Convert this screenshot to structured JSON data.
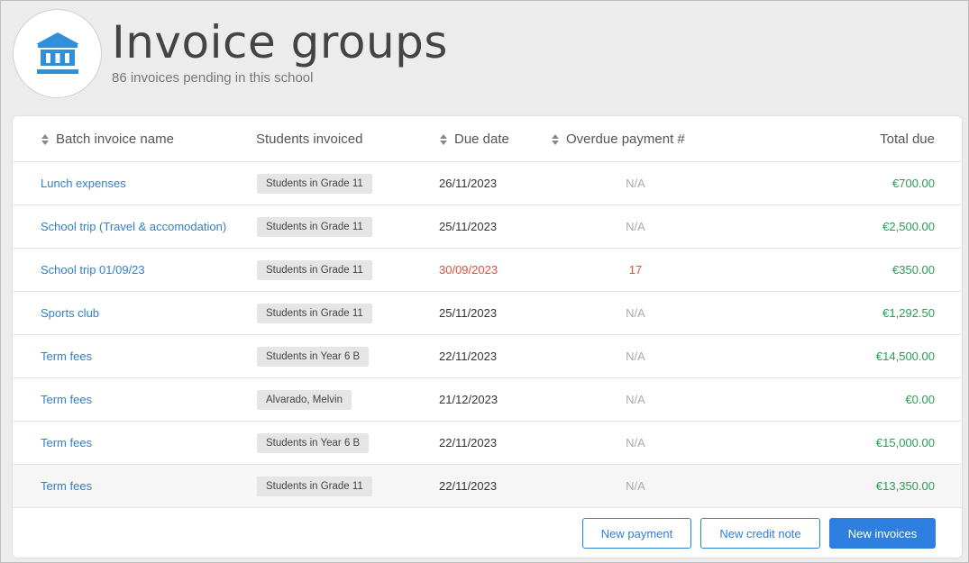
{
  "header": {
    "title": "Invoice groups",
    "subtitle": "86 invoices pending in this school",
    "icon": "bank-icon",
    "accent_color": "#2f8fd8"
  },
  "table": {
    "columns": {
      "name": "Batch invoice name",
      "students": "Students invoiced",
      "due": "Due date",
      "overdue": "Overdue payment #",
      "total": "Total due"
    },
    "rows": [
      {
        "name": "Lunch expenses",
        "group": "Students in Grade 11",
        "due": "26/11/2023",
        "overdue": "N/A",
        "total": "€700.00"
      },
      {
        "name": "School trip (Travel & accomodation)",
        "group": "Students in Grade 11",
        "due": "25/11/2023",
        "overdue": "N/A",
        "total": "€2,500.00"
      },
      {
        "name": "School trip 01/09/23",
        "group": "Students in Grade 11",
        "due": "30/09/2023",
        "overdue": "17",
        "total": "€350.00",
        "is_overdue": true
      },
      {
        "name": "Sports club",
        "group": "Students in Grade 11",
        "due": "25/11/2023",
        "overdue": "N/A",
        "total": "€1,292.50"
      },
      {
        "name": "Term fees",
        "group": "Students in Year 6 B",
        "due": "22/11/2023",
        "overdue": "N/A",
        "total": "€14,500.00"
      },
      {
        "name": "Term fees",
        "group": "Alvarado, Melvin",
        "due": "21/12/2023",
        "overdue": "N/A",
        "total": "€0.00"
      },
      {
        "name": "Term fees",
        "group": "Students in Year 6 B",
        "due": "22/11/2023",
        "overdue": "N/A",
        "total": "€15,000.00"
      },
      {
        "name": "Term fees",
        "group": "Students in Grade 11",
        "due": "22/11/2023",
        "overdue": "N/A",
        "total": "€13,350.00",
        "hovered": true
      }
    ]
  },
  "actions": {
    "new_payment": "New payment",
    "new_credit_note": "New credit note",
    "new_invoices": "New invoices"
  },
  "colors": {
    "link": "#2f7fd2",
    "amount": "#2a9d4f",
    "overdue": "#e74c3c",
    "primary_button": "#2f7fe0"
  }
}
